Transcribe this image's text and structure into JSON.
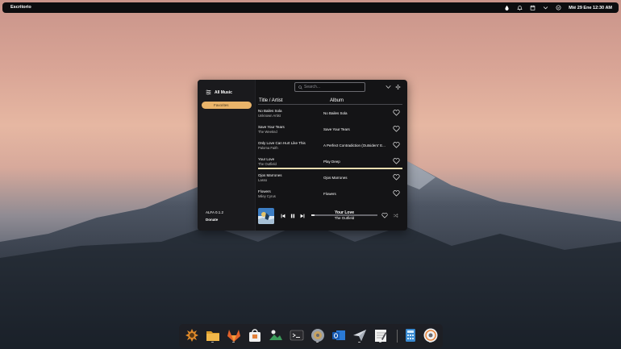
{
  "topbar": {
    "workspace": "Escritorio",
    "clock": "Mié 29 Ene  12:30 AM",
    "icons": [
      "drop-icon",
      "bell-icon",
      "calendar-icon",
      "chevron-down-icon",
      "power-icon"
    ]
  },
  "window": {
    "search_placeholder": "Search...",
    "sidebar": {
      "header": "All Music",
      "favorites": "Favorites",
      "version": "ALFA 0.1.2",
      "donate": "Donate"
    },
    "columns": {
      "title": "Title / Artist",
      "album": "Album"
    },
    "songs": [
      {
        "title": "No Bailes Sola",
        "artist": "Unknown Artist",
        "album": "No Bailes Sola"
      },
      {
        "title": "Save Your Tears",
        "artist": "The Weeknd",
        "album": "Save Your Tears"
      },
      {
        "title": "Only Love Can Hurt Like This",
        "artist": "Paloma Faith",
        "album": "A Perfect Contradiction (Outsiders' E..."
      },
      {
        "title": "Your Love",
        "artist": "The Outfield",
        "album": "Play Deep"
      },
      {
        "title": "Ojos Marrones",
        "artist": "Lasso",
        "album": "Ojos Marrones"
      },
      {
        "title": "Flowers",
        "artist": "Miley Cyrus",
        "album": "Flowers"
      }
    ],
    "playing_index": 3,
    "player": {
      "title": "Your Love",
      "artist": "The Outfield",
      "progress": 0.05
    }
  },
  "dock": {
    "apps": [
      "settings-tool-icon",
      "files-icon",
      "gitlab-icon",
      "software-store-icon",
      "photos-icon",
      "terminal-icon",
      "settings-gear-icon",
      "outlook-icon",
      "paper-plane-icon",
      "text-editor-icon",
      "calculator-icon",
      "music-disc-icon"
    ]
  }
}
